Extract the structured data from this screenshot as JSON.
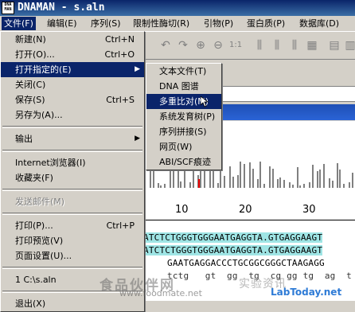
{
  "window": {
    "title": "DNAMAN - s.aln",
    "icon_text": "DNA MAN"
  },
  "menubar": [
    {
      "label": "文件(F)"
    },
    {
      "label": "编辑(E)"
    },
    {
      "label": "序列(S)"
    },
    {
      "label": "限制性酶切(R)"
    },
    {
      "label": "引物(P)"
    },
    {
      "label": "蛋白质(P)"
    },
    {
      "label": "数据库(D)"
    }
  ],
  "file_menu": {
    "items": [
      {
        "label": "新建(N)",
        "shortcut": "Ctrl+N"
      },
      {
        "label": "打开(O)...",
        "shortcut": "Ctrl+O"
      },
      {
        "label": "打开指定的(E)",
        "shortcut": ""
      },
      {
        "label": "关闭(C)",
        "shortcut": ""
      },
      {
        "label": "保存(S)",
        "shortcut": "Ctrl+S"
      },
      {
        "label": "另存为(A)...",
        "shortcut": ""
      },
      {
        "label": "输出",
        "shortcut": ""
      },
      {
        "label": "Internet浏览器(I)",
        "shortcut": ""
      },
      {
        "label": "收藏夹(F)",
        "shortcut": ""
      },
      {
        "label": "发送邮件(M)",
        "shortcut": ""
      },
      {
        "label": "打印(P)...",
        "shortcut": "Ctrl+P"
      },
      {
        "label": "打印预览(V)",
        "shortcut": ""
      },
      {
        "label": "页面设置(U)...",
        "shortcut": ""
      },
      {
        "label": "1 C:\\s.aln",
        "shortcut": ""
      },
      {
        "label": "退出(X)",
        "shortcut": ""
      }
    ]
  },
  "submenu": {
    "items": [
      {
        "label": "文本文件(T)"
      },
      {
        "label": "DNA 图谱"
      },
      {
        "label": "多重比对(M)"
      },
      {
        "label": "系统发育树(P)"
      },
      {
        "label": "序列拼接(S)"
      },
      {
        "label": "网页(W)"
      },
      {
        "label": "ABI/SCF痕迹"
      }
    ]
  },
  "ruler": {
    "labels": [
      "10",
      "20",
      "30"
    ]
  },
  "sequences": {
    "row1": "ATCTCTGGGTGGGAATGAGGTA.GTGAGGAAGT",
    "row2": "ATCTCTGGGTGGGAATGAGGTA.GTGAGGAAGT",
    "row3": "GAATGAGGACCCTGCGGCGGGCTAAGAGG",
    "row4": "tctg   gt  gg  tg  cg gg tg  ag  t"
  },
  "watermarks": {
    "cn_food": "食品伙伴网",
    "food_url": "www.foodmate.net",
    "cn_lab": "实验资讯",
    "lab_url": "LabToday.net"
  }
}
